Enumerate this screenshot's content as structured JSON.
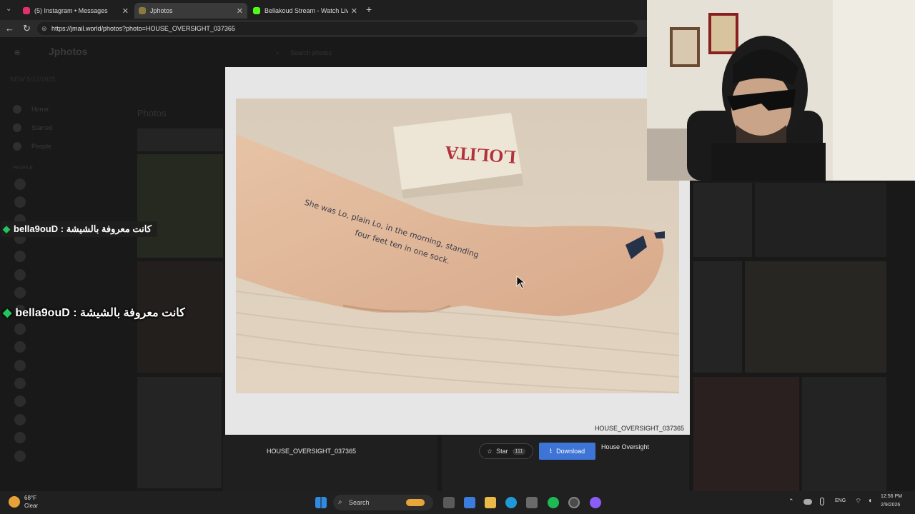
{
  "browser": {
    "tabs": [
      {
        "title": "(5) Instagram • Messages",
        "favicon_color": "#e1306c",
        "active": false
      },
      {
        "title": "Jphotos",
        "favicon_color": "#8a7a40",
        "active": true
      },
      {
        "title": "Bellakoud Stream - Watch Live on",
        "favicon_color": "#53fc18",
        "active": false
      }
    ],
    "new_tab_icon": "plus-icon",
    "url": "https://jmail.world/photos?photo=HOUSE_OVERSIGHT_037365"
  },
  "page": {
    "logo": "Jphotos",
    "search_placeholder": "Search photos",
    "banner": "NEW 5/12/2025",
    "nav": [
      "Home",
      "Starred",
      "People"
    ],
    "people_heading": "PEOPLE",
    "section_title": "Photos"
  },
  "viewer": {
    "caption": "HOUSE_OVERSIGHT_037365",
    "photo_book_title": "LOLITA",
    "photo_handwriting_line1": "She was Lo, plain Lo, in the morning, standing",
    "photo_handwriting_line2": "four feet ten in one sock."
  },
  "file_bar": {
    "file_name": "HOUSE_OVERSIGHT_037365",
    "star_label": "Star",
    "star_count": "111",
    "download_label": "Download",
    "collection": "House Oversight"
  },
  "chat": {
    "message_1": "bella9ouD : كانت معروفة بالشيشة",
    "message_2": "bella9ouD : كانت معروفة بالشيشة",
    "gem_color": "#22c55e"
  },
  "taskbar": {
    "temperature": "68°F",
    "weather": "Clear",
    "search_label": "Search",
    "language": "ENG",
    "time": "12:56 PM",
    "date": "2/9/2026",
    "accent": "#0078d4"
  }
}
